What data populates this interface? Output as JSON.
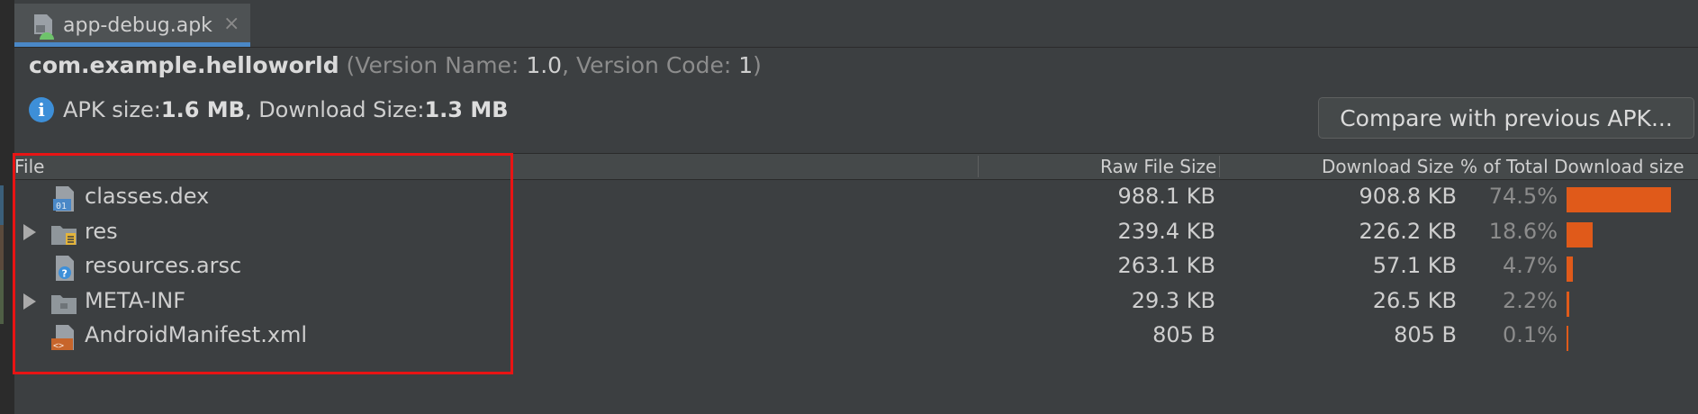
{
  "tab": {
    "title": "app-debug.apk",
    "close": "×"
  },
  "header": {
    "package": "com.example.helloworld",
    "version_open": "(Version Name: ",
    "version_name": "1.0",
    "version_mid": ", Version Code: ",
    "version_code": "1",
    "version_close": ")",
    "apk_size_label": "APK size: ",
    "apk_size": "1.6 MB",
    "download_label": ", Download Size: ",
    "download_size": "1.3 MB",
    "info_glyph": "i"
  },
  "compare_button": "Compare with previous APK...",
  "columns": {
    "file": "File",
    "raw": "Raw File Size",
    "download": "Download Size",
    "percent": "% of Total Download size"
  },
  "rows": [
    {
      "name": "classes.dex",
      "raw": "988.1 KB",
      "download": "908.8 KB",
      "percent": "74.5%",
      "share": 0.745,
      "icon": "dex-file-icon",
      "expandable": false
    },
    {
      "name": "res",
      "raw": "239.4 KB",
      "download": "226.2 KB",
      "percent": "18.6%",
      "share": 0.186,
      "icon": "resource-folder-icon",
      "expandable": true
    },
    {
      "name": "resources.arsc",
      "raw": "263.1 KB",
      "download": "57.1 KB",
      "percent": "4.7%",
      "share": 0.047,
      "icon": "unknown-file-icon",
      "expandable": false
    },
    {
      "name": "META-INF",
      "raw": "29.3 KB",
      "download": "26.5 KB",
      "percent": "2.2%",
      "share": 0.022,
      "icon": "folder-icon",
      "expandable": true
    },
    {
      "name": "AndroidManifest.xml",
      "raw": "805 B",
      "download": "805 B",
      "percent": "0.1%",
      "share": 0.001,
      "icon": "xml-file-icon",
      "expandable": false
    }
  ],
  "colors": {
    "bar": "#e05a1a",
    "highlight": "#e81414",
    "accent": "#4a88c7"
  }
}
